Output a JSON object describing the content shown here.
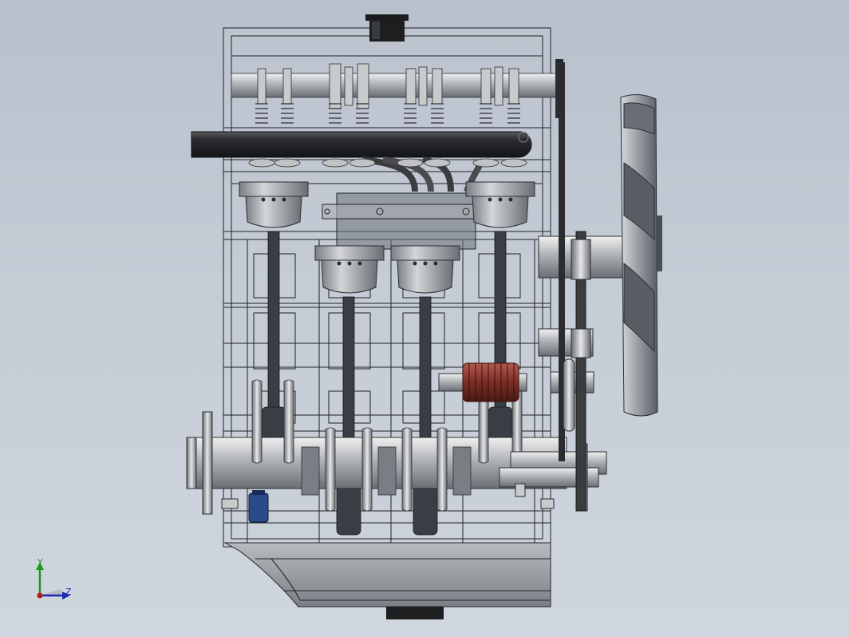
{
  "viewport": {
    "background_top": "#b8c0cc",
    "background_bottom": "#d0d6de"
  },
  "model": {
    "description_icon": "engine-assembly",
    "colors": {
      "metal_light": "#d8dadc",
      "metal_mid": "#9a9ea4",
      "metal_dark": "#4a4e54",
      "edge": "#1e2226",
      "rod": "#3a3e44",
      "filter_red": "#8a3a30",
      "sensor_blue": "#2a4a8a",
      "exhaust": "#2a2c30"
    }
  },
  "triad": {
    "y_label": "Y",
    "z_label": "Z",
    "y_color": "#1a9a1a",
    "z_color": "#1a2ab0",
    "origin_color": "#b01a1a"
  }
}
